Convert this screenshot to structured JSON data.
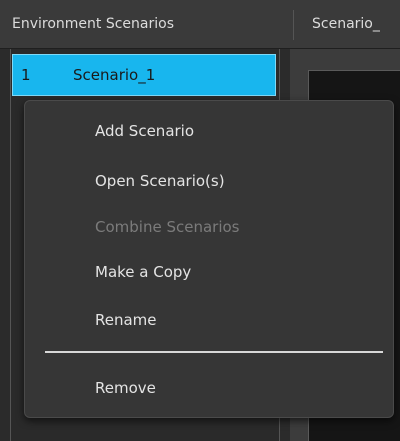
{
  "tabs": {
    "environment_scenarios": "Environment Scenarios",
    "scenario_truncated": "Scenario_"
  },
  "scenario_list": {
    "items": [
      {
        "number": "1",
        "name": "Scenario_1",
        "selected": true
      }
    ]
  },
  "context_menu": {
    "add_scenario": "Add Scenario",
    "open_scenarios": "Open Scenario(s)",
    "combine_scenarios": "Combine Scenarios",
    "make_a_copy": "Make a Copy",
    "rename": "Rename",
    "remove": "Remove",
    "disabled_items": [
      "Combine Scenarios"
    ]
  },
  "colors": {
    "selection": "#18b6ee",
    "menu_background": "#363636",
    "app_background": "#2b2b2b",
    "disabled_text": "#7b7b7b"
  }
}
